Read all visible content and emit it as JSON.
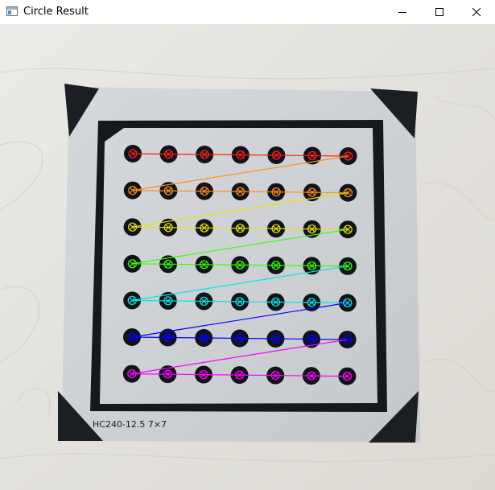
{
  "window": {
    "title": "Circle Result",
    "icon": "app-window-icon",
    "controls": [
      "minimize-icon",
      "maximize-icon",
      "close-icon"
    ]
  },
  "board": {
    "label": "HC240-12.5  7×7",
    "grid_rows": 7,
    "grid_cols": 7
  },
  "detection": {
    "marker_icon": "circle-x-marker",
    "row_colors": [
      "#ff1a1a",
      "#ff8c1a",
      "#e6e600",
      "#33ff00",
      "#00e6e6",
      "#0000ff",
      "#ff00ff"
    ],
    "board_color": "#cfd3d6",
    "dot_color": "#101418",
    "frame_color": "#15181c",
    "background_wood": "#e6e4df"
  }
}
